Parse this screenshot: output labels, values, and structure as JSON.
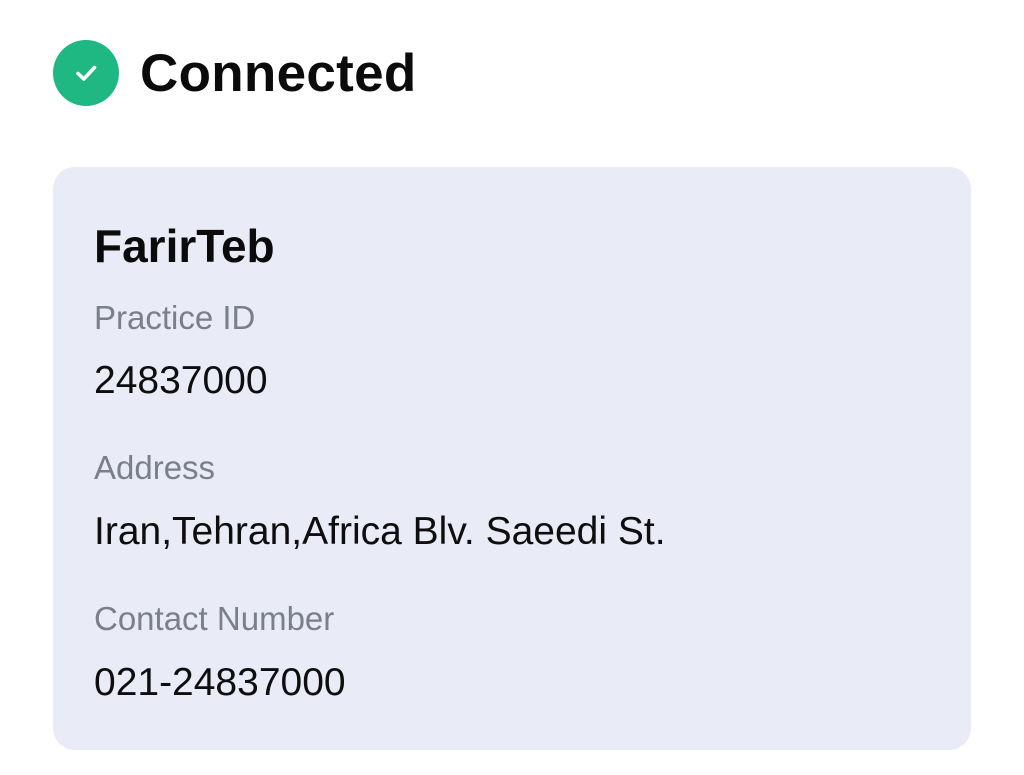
{
  "status": {
    "title": "Connected",
    "icon": "check-circle-icon",
    "color": "#1fb883"
  },
  "practice": {
    "name": "FarirTeb",
    "fields": [
      {
        "label": "Practice ID",
        "value": "24837000"
      },
      {
        "label": "Address",
        "value": "Iran,Tehran,Africa Blv. Saeedi St."
      },
      {
        "label": "Contact Number",
        "value": "021-24837000"
      }
    ]
  },
  "colors": {
    "card_background": "#e9ebf6",
    "label": "#7b7f8b",
    "text": "#0b0b0b"
  }
}
